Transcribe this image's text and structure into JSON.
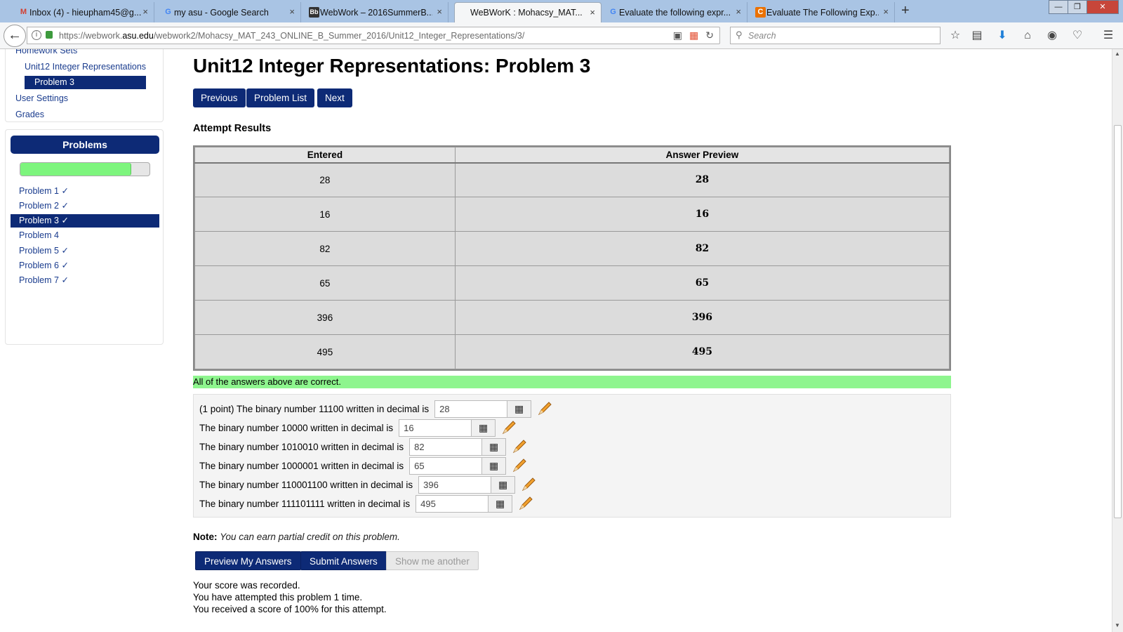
{
  "browser": {
    "tabs": [
      {
        "title": "Inbox (4) - hieupham45@g...",
        "favicon": "M"
      },
      {
        "title": "my asu - Google Search",
        "favicon": "G"
      },
      {
        "title": "WebWork – 2016SummerB...",
        "favicon": "Bb"
      },
      {
        "title": "WeBWorK : Mohacsy_MAT...",
        "favicon": ""
      },
      {
        "title": "Evaluate the following expr...",
        "favicon": "G"
      },
      {
        "title": "Evaluate The Following Exp...",
        "favicon": "C"
      }
    ],
    "close_glyph": "×",
    "new_tab_glyph": "+",
    "url_prefix": "https://webwork.",
    "url_host": "asu.edu",
    "url_path": "/webwork2/Mohacsy_MAT_243_ONLINE_B_Summer_2016/Unit12_Integer_Representations/3/",
    "search_placeholder": "Search"
  },
  "sidebar": {
    "homework_sets": "Homework Sets",
    "set_name": "Unit12 Integer Representations",
    "current_problem": "Problem 3",
    "user_settings": "User Settings",
    "grades": "Grades",
    "problems_title": "Problems",
    "progress_fraction": 0.86,
    "problems": [
      {
        "label": "Problem 1 ✓"
      },
      {
        "label": "Problem 2 ✓"
      },
      {
        "label": "Problem 3 ✓"
      },
      {
        "label": "Problem 4"
      },
      {
        "label": "Problem 5 ✓"
      },
      {
        "label": "Problem 6 ✓"
      },
      {
        "label": "Problem 7 ✓"
      }
    ]
  },
  "main": {
    "title": "Unit12 Integer Representations: Problem 3",
    "nav": {
      "previous": "Previous",
      "problem_list": "Problem List",
      "next": "Next"
    },
    "attempt_results_title": "Attempt Results",
    "table": {
      "headers": [
        "Entered",
        "Answer Preview"
      ],
      "rows": [
        [
          "28",
          "28"
        ],
        [
          "16",
          "16"
        ],
        [
          "82",
          "82"
        ],
        [
          "65",
          "65"
        ],
        [
          "396",
          "396"
        ],
        [
          "495",
          "495"
        ]
      ]
    },
    "correct_message": "All of the answers above are correct.",
    "questions": [
      {
        "text": "(1 point) The binary number 11100 written in decimal is",
        "value": "28"
      },
      {
        "text": "The binary number 10000 written in decimal is",
        "value": "16"
      },
      {
        "text": "The binary number 1010010 written in decimal is",
        "value": "82"
      },
      {
        "text": "The binary number 1000001 written in decimal is",
        "value": "65"
      },
      {
        "text": "The binary number 110001100 written in decimal is",
        "value": "396"
      },
      {
        "text": "The binary number 111101111 written in decimal is",
        "value": "495"
      }
    ],
    "note_label": "Note:",
    "note_text": "You can earn partial credit on this problem.",
    "buttons": {
      "preview": "Preview My Answers",
      "submit": "Submit Answers",
      "show_another": "Show me another"
    },
    "score_lines": [
      "Your score was recorded.",
      "You have attempted this problem 1 time.",
      "You received a score of 100% for this attempt."
    ]
  }
}
